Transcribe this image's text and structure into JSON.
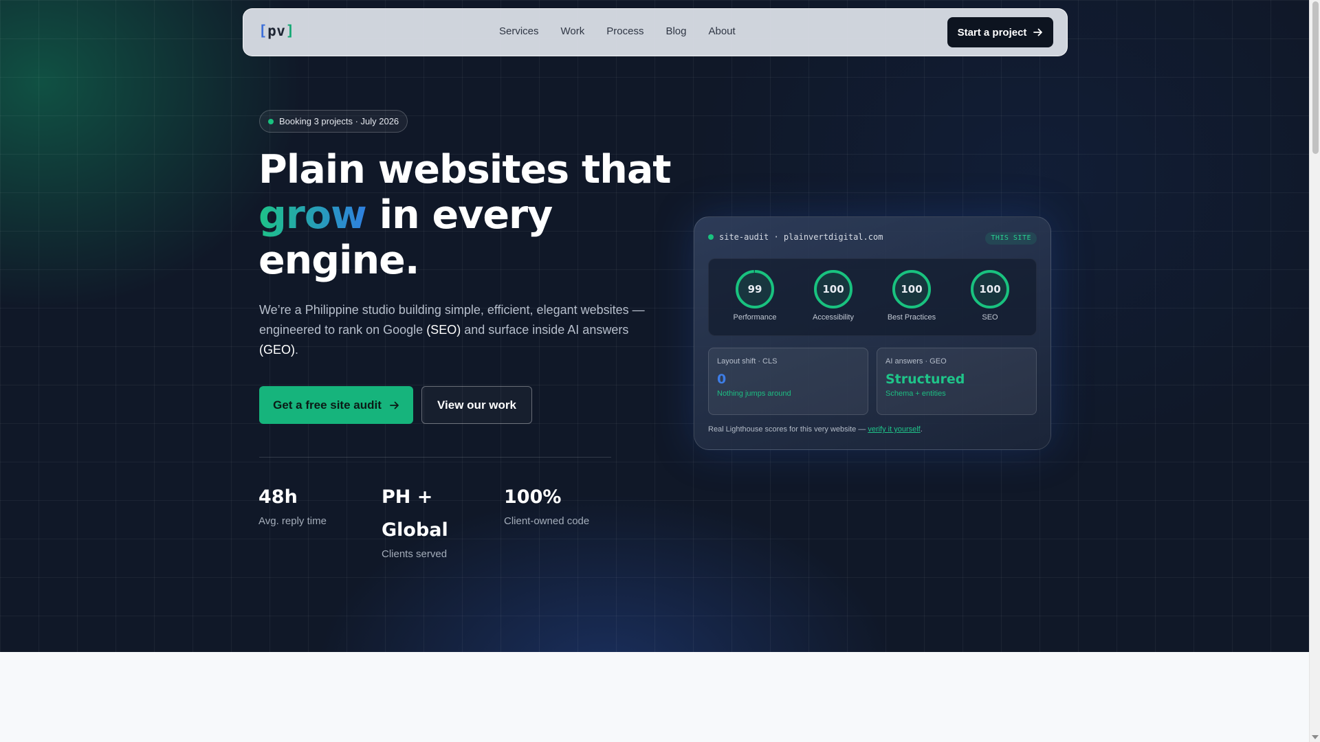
{
  "nav": {
    "logo_open": "[",
    "logo_text": "pv",
    "logo_close": "]",
    "links": [
      "Services",
      "Work",
      "Process",
      "Blog",
      "About"
    ],
    "cta_label": "Start a project",
    "cta_icon": "arrow-right-icon"
  },
  "hero": {
    "badge": "Booking 3 projects · July 2026",
    "title_line1": "Plain websites that",
    "title_accent": "grow",
    "title_rest": " in every engine.",
    "lead_part1": "We’re a Philippine studio building simple, efficient, elegant websites — engineered to rank on Google ",
    "lead_seo": "(SEO)",
    "lead_part2": " and surface inside AI answers ",
    "lead_geo": "(GEO)",
    "lead_end": ".",
    "primary_cta": "Get a free site audit",
    "secondary_cta": "View our work",
    "accent_color": "#16b47c"
  },
  "stats": [
    {
      "value": "48h",
      "label": "Avg. reply time"
    },
    {
      "value": "PH + Global",
      "label": "Clients served"
    },
    {
      "value": "100%",
      "label": "Client-owned code"
    }
  ],
  "audit": {
    "header": "site-audit · plainvertdigital.com",
    "tag": "THIS SITE",
    "scores": [
      {
        "value": 99,
        "label": "Performance"
      },
      {
        "value": 100,
        "label": "Accessibility"
      },
      {
        "value": 100,
        "label": "Best Practices"
      },
      {
        "value": 100,
        "label": "SEO"
      }
    ],
    "cls": {
      "title": "Layout shift · CLS",
      "value": "0",
      "note": "Nothing jumps around"
    },
    "geo": {
      "title": "AI answers · GEO",
      "value": "Structured",
      "note": "Schema + entities"
    },
    "footer_text": "Real Lighthouse scores for this very website — ",
    "footer_link": "verify it yourself",
    "footer_end": "."
  }
}
